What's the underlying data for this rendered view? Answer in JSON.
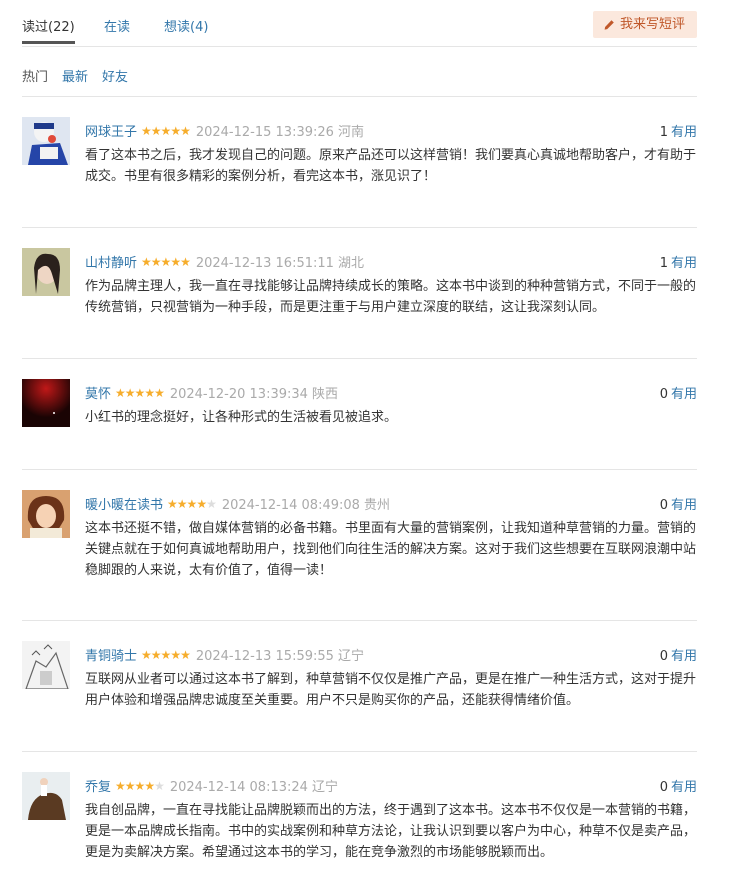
{
  "tabs": {
    "read": "读过(22)",
    "reading": "在读",
    "want": "想读(4)",
    "write_button": "我来写短评"
  },
  "sorts": {
    "hot": "热门",
    "latest": "最新",
    "friends": "好友"
  },
  "reviews": [
    {
      "user": "网球王子",
      "rating": 5,
      "time": "2024-12-15 13:39:26 河南",
      "useful_count": "1",
      "useful_label": "有用",
      "content": "看了这本书之后，我才发现自己的问题。原来产品还可以这样营销！我们要真心真诚地帮助客户，才有助于成交。书里有很多精彩的案例分析，看完这本书，涨见识了！"
    },
    {
      "user": "山村静听",
      "rating": 5,
      "time": "2024-12-13 16:51:11 湖北",
      "useful_count": "1",
      "useful_label": "有用",
      "content": "作为品牌主理人，我一直在寻找能够让品牌持续成长的策略。这本书中谈到的种种营销方式，不同于一般的传统营销，只视营销为一种手段，而是更注重于与用户建立深度的联结，这让我深刻认同。"
    },
    {
      "user": "莫怀",
      "rating": 5,
      "time": "2024-12-20 13:39:34 陕西",
      "useful_count": "0",
      "useful_label": "有用",
      "content": "小红书的理念挺好，让各种形式的生活被看见被追求。"
    },
    {
      "user": "暖小暖在读书",
      "rating": 4,
      "time": "2024-12-14 08:49:08 贵州",
      "useful_count": "0",
      "useful_label": "有用",
      "content": "这本书还挺不错，做自媒体营销的必备书籍。书里面有大量的营销案例，让我知道种草营销的力量。营销的关键点就在于如何真诚地帮助用户，找到他们向往生活的解决方案。这对于我们这些想要在互联网浪潮中站稳脚跟的人来说，太有价值了，值得一读！"
    },
    {
      "user": "青铜骑士",
      "rating": 5,
      "time": "2024-12-13 15:59:55 辽宁",
      "useful_count": "0",
      "useful_label": "有用",
      "content": "互联网从业者可以通过这本书了解到，种草营销不仅仅是推广产品，更是在推广一种生活方式，这对于提升用户体验和增强品牌忠诚度至关重要。用户不只是购买你的产品，还能获得情绪价值。"
    },
    {
      "user": "乔复",
      "rating": 4,
      "time": "2024-12-14 08:13:24 辽宁",
      "useful_count": "0",
      "useful_label": "有用",
      "content": "我自创品牌，一直在寻找能让品牌脱颖而出的方法，终于遇到了这本书。这本书不仅仅是一本营销的书籍，更是一本品牌成长指南。书中的实战案例和种草方法论，让我认识到要以客户为中心，种草不仅是卖产品，更是为卖解决方案。希望通过这本书的学习，能在竞争激烈的市场能够脱颖而出。"
    }
  ]
}
